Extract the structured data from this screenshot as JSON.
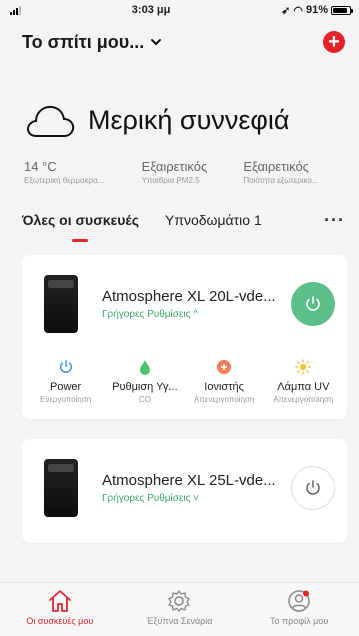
{
  "status_bar": {
    "time": "3:03 μμ",
    "battery": "91%"
  },
  "header": {
    "home_name": "Το σπίτι μου..."
  },
  "weather": {
    "condition": "Μερική συννεφιά"
  },
  "stats": [
    {
      "value": "14 °C",
      "label": "Εξωτερική θερμοκρα..."
    },
    {
      "value": "Εξαιρετικός",
      "label": "Υπαίθρια PM2.5"
    },
    {
      "value": "Εξαιρετικός",
      "label": "Ποιότητα εξωτερικο..."
    }
  ],
  "tabs": [
    {
      "label": "Όλες οι συσκευές"
    },
    {
      "label": "Υπνοδωμάτιο 1"
    }
  ],
  "devices": [
    {
      "name": "Atmosphere XL 20L-vde...",
      "quick": "Γρήγορες Ρυθμίσεις ^",
      "controls": [
        {
          "name": "Power",
          "state": "Ενεργοποίηση"
        },
        {
          "name": "Ρυθμιση Υγ...",
          "state": "CO"
        },
        {
          "name": "Ιονιστής",
          "state": "Απενεργοποίηση"
        },
        {
          "name": "Λάμπα UV",
          "state": "Απενεργοποίηση"
        }
      ]
    },
    {
      "name": "Atmosphere XL 25L-vde...",
      "quick": "Γρήγορες Ρυθμίσεις ˅"
    }
  ],
  "bottom_nav": [
    {
      "label": "Οι συσκευές μου"
    },
    {
      "label": "Έξυπνα Σενάρια"
    },
    {
      "label": "Το προφίλ μου"
    }
  ],
  "colors": {
    "accent": "#e3242b",
    "power_on": "#5bbf89",
    "quick": "#3aa86b"
  }
}
